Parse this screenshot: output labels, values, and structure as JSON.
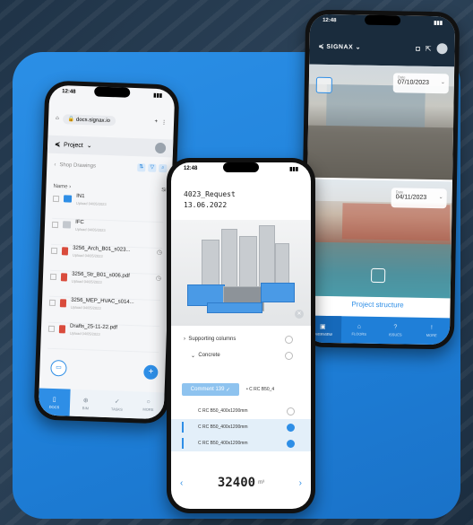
{
  "left_phone": {
    "time": "12:48",
    "url": "docs.signax.io",
    "project_label": "Project",
    "breadcrumb": "Shop Drawings",
    "col_name": "Name",
    "col_size": "Si",
    "files": [
      {
        "name": "IN1",
        "sub": "Upload 04/05/2023",
        "type": "folder"
      },
      {
        "name": "IFC",
        "sub": "Upload 04/05/2023",
        "type": "folder-grey"
      },
      {
        "name": "3256_Arch_B01_s023...",
        "sub": "Upload 04/05/2023",
        "type": "pdf"
      },
      {
        "name": "3256_Str_B01_s006.pdf",
        "sub": "Upload 04/05/2023",
        "type": "pdf"
      },
      {
        "name": "3256_MEP_HVAC_s014...",
        "sub": "Upload 04/05/2023",
        "type": "pdf"
      },
      {
        "name": "Drafts_25-11-22.pdf",
        "sub": "Upload 04/05/2023",
        "type": "pdf"
      }
    ],
    "tabs": [
      {
        "label": "DOCS",
        "icon": "▯"
      },
      {
        "label": "BIM",
        "icon": "⊕"
      },
      {
        "label": "TASKS",
        "icon": "✓"
      },
      {
        "label": "MORE",
        "icon": "○"
      }
    ]
  },
  "right_phone": {
    "time": "12:48",
    "brand": "SIGNAX",
    "date_label": "Date",
    "date1": "07/10/2023",
    "date2": "04/11/2023",
    "title": "Project structure",
    "tabs": [
      {
        "label": "OVERVIEW",
        "icon": "▣"
      },
      {
        "label": "FLOORS",
        "icon": "⌂"
      },
      {
        "label": "ISSUES",
        "icon": "?"
      },
      {
        "label": "MORE",
        "icon": "!"
      }
    ]
  },
  "middle_phone": {
    "time": "12:48",
    "title_line1": "4023_Request",
    "title_line2": "13.06.2022",
    "tree": [
      {
        "label": "Supporting columns",
        "prefix": "›"
      },
      {
        "label": "Concrete",
        "prefix": "⌄"
      }
    ],
    "comment_label": "Comment 139",
    "comment_value": "C RC B50_4",
    "items": [
      {
        "label": "C RC B50_400x1200mm",
        "checked": false
      },
      {
        "label": "C RC B50_400x1200mm",
        "checked": true
      },
      {
        "label": "C RC B50_400x1200mm",
        "checked": true
      }
    ],
    "quantity": "32400",
    "unit": "m³"
  },
  "colors": {
    "accent": "#2e8ee6",
    "background": "#1f3347",
    "card": "#1e7fd8"
  }
}
